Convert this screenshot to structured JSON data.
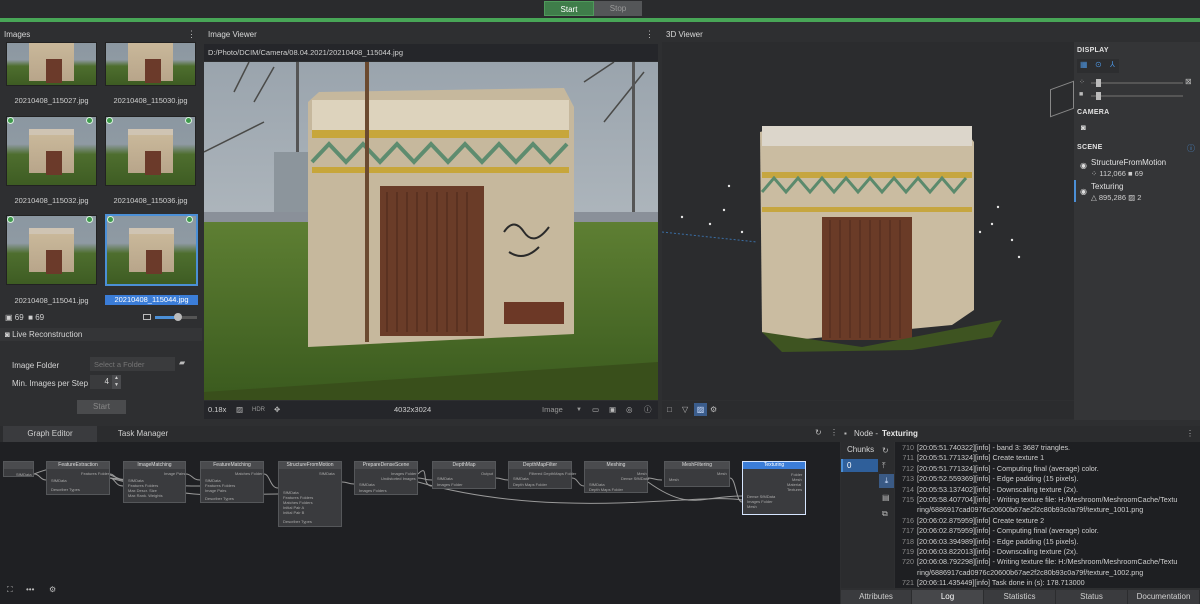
{
  "toolbar": {
    "start_label": "Start",
    "stop_label": "Stop"
  },
  "images_panel": {
    "title": "Images",
    "thumbs": [
      {
        "name": "20210408_115027.jpg"
      },
      {
        "name": "20210408_115030.jpg"
      },
      {
        "name": "20210408_115032.jpg"
      },
      {
        "name": "20210408_115036.jpg"
      },
      {
        "name": "20210408_115041.jpg"
      },
      {
        "name": "20210408_115044.jpg"
      }
    ],
    "image_count": "69",
    "camera_count": "69",
    "live_reconstruction_label": "Live Reconstruction",
    "image_folder_label": "Image Folder",
    "image_folder_placeholder": "Select a Folder",
    "min_images_label": "Min. Images per Step",
    "min_images_value": "4",
    "start_label": "Start"
  },
  "image_viewer": {
    "title": "Image Viewer",
    "path": "D:/Photo/DCIM/Camera/08.04.2021/20210408_115044.jpg",
    "zoom": "0.18x",
    "hdr_label": "HDR",
    "resolution": "4032x3024",
    "mode_label": "Image"
  },
  "viewer3d": {
    "title": "3D Viewer"
  },
  "display_panel": {
    "display_title": "DISPLAY",
    "camera_title": "CAMERA",
    "scene_title": "SCENE",
    "scene_items": [
      {
        "name": "StructureFromMotion",
        "stat1": "112,066",
        "stat2": "69"
      },
      {
        "name": "Texturing",
        "stat1": "895,286",
        "stat2": "2"
      }
    ],
    "slider1_level": 0.05,
    "slider2_level": 0.05
  },
  "graph_editor": {
    "tabs": [
      "Graph Editor",
      "Task Manager"
    ],
    "nodes": [
      {
        "title": "",
        "ports": [
          "SfMData"
        ]
      },
      {
        "title": "FeatureExtraction",
        "ports": [
          "SfMData",
          "Describer Types"
        ],
        "outputs": [
          "Features Folder"
        ]
      },
      {
        "title": "ImageMatching",
        "ports": [
          "SfMData",
          "Features Folders",
          "Max Descr. Size",
          "Max Rank. Weights"
        ],
        "outputs": [
          "Image Pairs"
        ]
      },
      {
        "title": "FeatureMatching",
        "ports": [
          "SfMData",
          "Features Folders",
          "Image Pairs",
          "Describer Types"
        ],
        "outputs": [
          "Matches Folder"
        ]
      },
      {
        "title": "StructureFromMotion",
        "ports": [
          "SfMData",
          "Features Folders",
          "Matches Folders",
          "Initial Pair A",
          "Initial Pair B",
          "Describer Types"
        ],
        "outputs": [
          "SfMData"
        ]
      },
      {
        "title": "PrepareDenseScene",
        "ports": [
          "SfMData",
          "Images Folders"
        ],
        "outputs": [
          "Images Folder",
          "Undistorted Images"
        ]
      },
      {
        "title": "DepthMap",
        "ports": [
          "SfMData",
          "Images Folder"
        ],
        "outputs": [
          "Output"
        ]
      },
      {
        "title": "DepthMapFilter",
        "ports": [
          "SfMData",
          "Depth Maps Folder"
        ],
        "outputs": [
          "Filtered DepthMaps Folder"
        ]
      },
      {
        "title": "Meshing",
        "ports": [
          "SfMData",
          "Depth Maps Folder"
        ],
        "outputs": [
          "Mesh",
          "Dense SfMData"
        ]
      },
      {
        "title": "MeshFiltering",
        "ports": [
          "Mesh"
        ],
        "outputs": [
          "Mesh"
        ]
      },
      {
        "title": "Texturing",
        "ports": [
          "Dense SfMData",
          "Images Folder",
          "Mesh"
        ],
        "outputs": [
          "Folder",
          "Mesh",
          "Material",
          "Textures"
        ]
      }
    ]
  },
  "node_panel": {
    "prefix": "Node - ",
    "name": "Texturing",
    "chunks_label": "Chunks",
    "chunk_index": "0",
    "log_lines": [
      {
        "n": "710",
        "text": "[20:05:51.740322][info]     - band 3: 3687 triangles."
      },
      {
        "n": "711",
        "text": "[20:05:51.771324][info] Create texture 1"
      },
      {
        "n": "712",
        "text": "[20:05:51.771324][info]   - Computing final (average) color."
      },
      {
        "n": "713",
        "text": "[20:05:52.559369][info]   - Edge padding (15 pixels)."
      },
      {
        "n": "714",
        "text": "[20:05:53.137402][info]   - Downscaling texture (2x)."
      },
      {
        "n": "715",
        "text": "[20:05:58.407704][info]   - Writing texture file: H:/Meshroom/MeshroomCache/Textu"
      },
      {
        "n": "",
        "text": "ring/6886917cad0976c20600b67ae2f2c80b93c0a79f/texture_1001.png"
      },
      {
        "n": "716",
        "text": "[20:06:02.875959][info] Create texture 2"
      },
      {
        "n": "717",
        "text": "[20:06:02.875959][info]   - Computing final (average) color."
      },
      {
        "n": "718",
        "text": "[20:06:03.394989][info]   - Edge padding (15 pixels)."
      },
      {
        "n": "719",
        "text": "[20:06:03.822013][info]   - Downscaling texture (2x)."
      },
      {
        "n": "720",
        "text": "[20:06:08.792298][info]   - Writing texture file: H:/Meshroom/MeshroomCache/Textu"
      },
      {
        "n": "",
        "text": "ring/6886917cad0976c20600b67ae2f2c80b93c0a79f/texture_1002.png"
      },
      {
        "n": "721",
        "text": "[20:06:11.435449][info] Task done in (s): 178.713000"
      },
      {
        "n": "722",
        "text": ""
      }
    ],
    "bottom_tabs": [
      "Attributes",
      "Log",
      "Statistics",
      "Status",
      "Documentation"
    ]
  }
}
